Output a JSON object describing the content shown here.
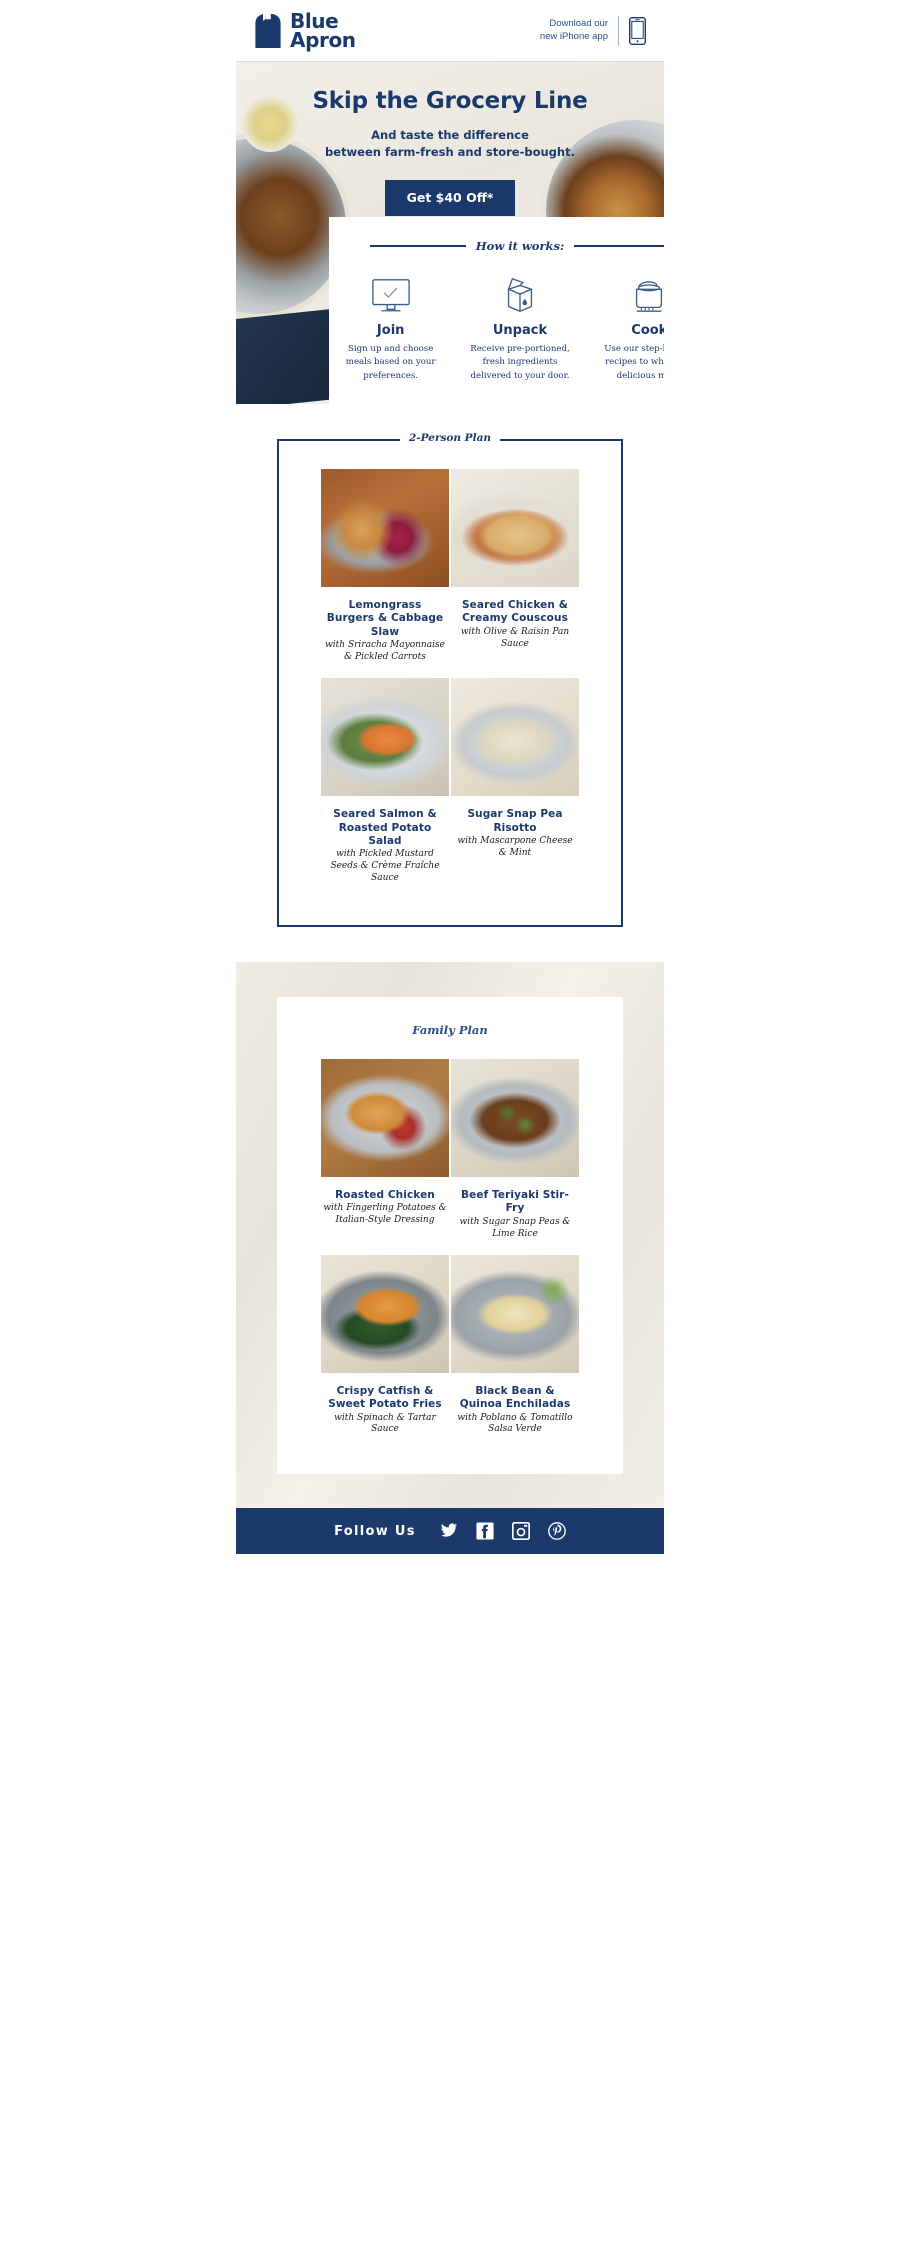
{
  "brand": {
    "name_line1": "Blue",
    "name_line2": "Apron",
    "color_primary": "#1b3a6b",
    "logo_icon": "apron-icon"
  },
  "header": {
    "download_line1": "Download our",
    "download_line2": "new iPhone app",
    "phone_icon": "iphone-icon"
  },
  "hero": {
    "title": "Skip the Grocery Line",
    "subtitle_line1": "And taste the difference",
    "subtitle_line2": "between farm-fresh and store-bought.",
    "cta_label": "Get $40 Off*"
  },
  "how_it_works": {
    "heading": "How it works:",
    "steps": [
      {
        "icon": "monitor-check-icon",
        "label": "Join",
        "description": "Sign up and choose meals based on your preferences."
      },
      {
        "icon": "open-box-icon",
        "label": "Unpack",
        "description": "Receive pre-portioned, fresh ingredients delivered to your door."
      },
      {
        "icon": "cooking-pot-icon",
        "label": "Cook",
        "description": "Use our step-by-step recipes to whip up a delicious meal."
      }
    ]
  },
  "two_person_plan": {
    "legend": "2-Person Plan",
    "meals": [
      {
        "name": "Lemongrass Burgers & Cabbage Slaw",
        "description": "with Sriracha Mayonnaise & Pickled Carrots",
        "image_alt": "lemongrass-burger-photo"
      },
      {
        "name": "Seared Chicken & Creamy Couscous",
        "description": "with Olive & Raisin Pan Sauce",
        "image_alt": "seared-chicken-couscous-photo"
      },
      {
        "name": "Seared Salmon & Roasted Potato Salad",
        "description": "with Pickled Mustard Seeds & Crème Fraîche Sauce",
        "image_alt": "seared-salmon-photo"
      },
      {
        "name": "Sugar Snap Pea Risotto",
        "description": "with Mascarpone Cheese & Mint",
        "image_alt": "snap-pea-risotto-photo"
      }
    ]
  },
  "family_plan": {
    "legend": "Family Plan",
    "meals": [
      {
        "name": "Roasted Chicken",
        "description": "with Fingerling Potatoes & Italian-Style Dressing",
        "image_alt": "roasted-chicken-photo"
      },
      {
        "name": "Beef Teriyaki Stir-Fry",
        "description": "with Sugar Snap Peas & Lime Rice",
        "image_alt": "beef-teriyaki-photo"
      },
      {
        "name": "Crispy Catfish & Sweet Potato Fries",
        "description": "with Spinach & Tartar Sauce",
        "image_alt": "crispy-catfish-photo"
      },
      {
        "name": "Black Bean & Quinoa Enchiladas",
        "description": "with Poblano & Tomatillo Salsa Verde",
        "image_alt": "black-bean-enchiladas-photo"
      }
    ]
  },
  "footer": {
    "follow_label": "Follow Us",
    "socials": [
      {
        "icon": "twitter-icon",
        "name": "Twitter"
      },
      {
        "icon": "facebook-icon",
        "name": "Facebook"
      },
      {
        "icon": "instagram-icon",
        "name": "Instagram"
      },
      {
        "icon": "pinterest-icon",
        "name": "Pinterest"
      }
    ],
    "background_color": "#1b3a6b"
  }
}
